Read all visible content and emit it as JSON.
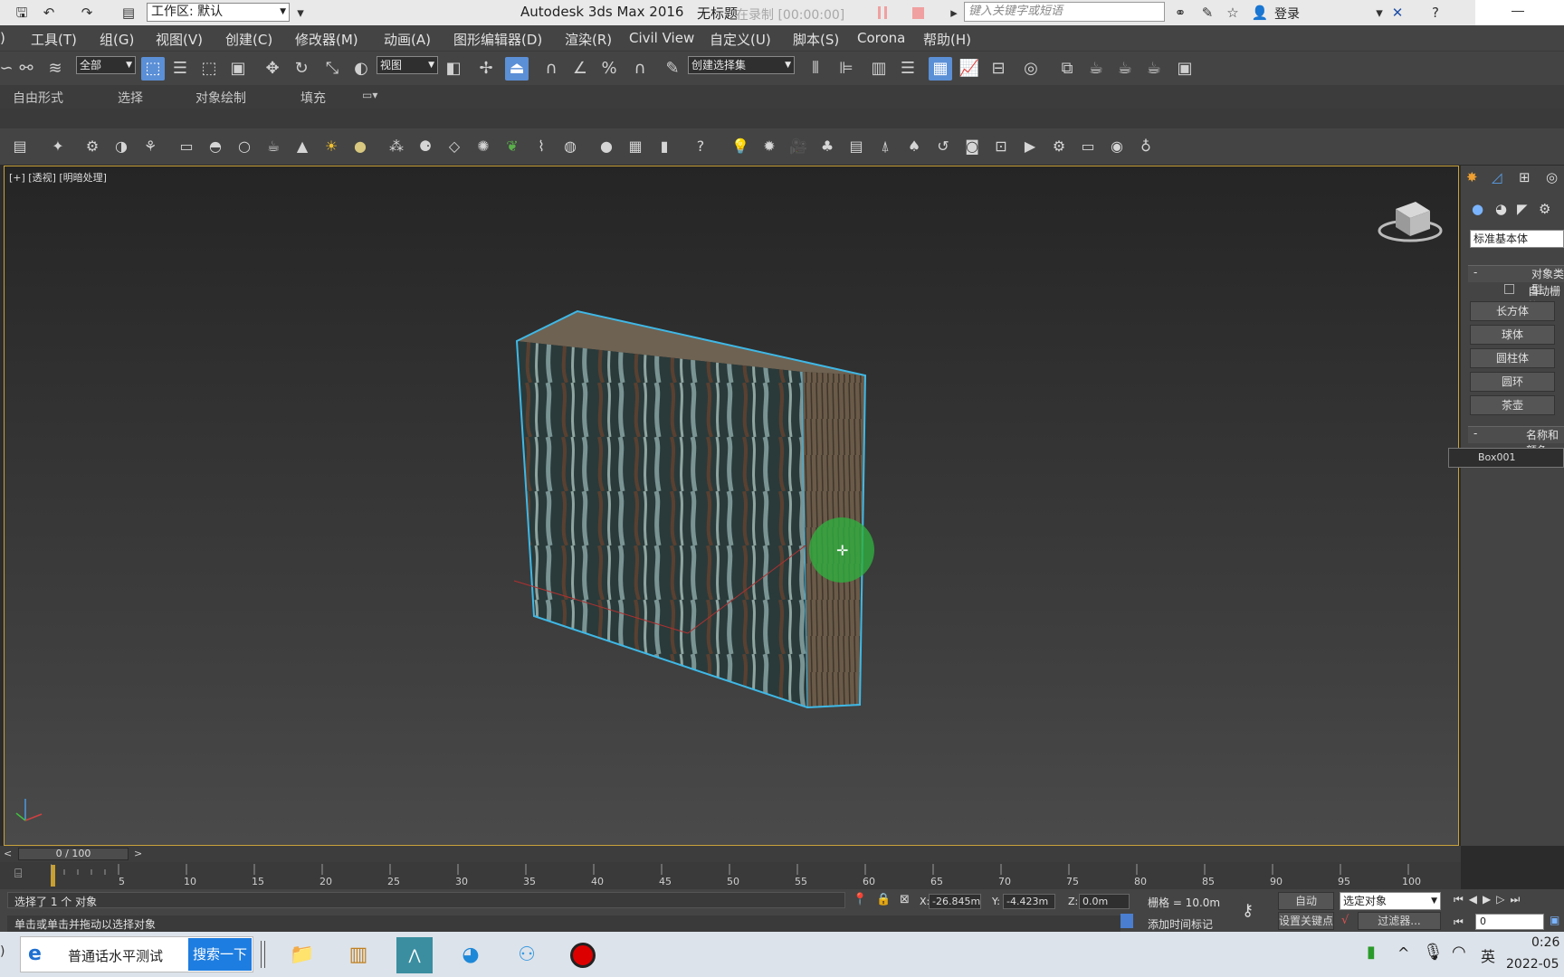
{
  "titlebar": {
    "workspace": "工作区: 默认",
    "app_title": "Autodesk 3ds Max 2016",
    "doc_title": "无标题",
    "recording": "在录制 [00:00:00]",
    "search_placeholder": "键入关键字或短语",
    "login": "登录"
  },
  "menu": [
    "工具(T)",
    "组(G)",
    "视图(V)",
    "创建(C)",
    "修改器(M)",
    "动画(A)",
    "图形编辑器(D)",
    "渲染(R)",
    "Civil View",
    "自定义(U)",
    "脚本(S)",
    "Corona",
    "帮助(H)"
  ],
  "toolbar": {
    "filter_dd": "全部",
    "ref_coord_dd": "视图",
    "selection_set_dd": "创建选择集"
  },
  "ribbon_tabs": [
    "自由形式",
    "选择",
    "对象绘制",
    "填充"
  ],
  "viewport": {
    "label": "[+] [透视] [明暗处理]"
  },
  "command_panel": {
    "category_dd": "标准基本体",
    "object_type_header": "对象类型",
    "autogrid": "自动栅格",
    "buttons": [
      "长方体",
      "球体",
      "圆柱体",
      "圆环",
      "茶壶"
    ],
    "name_color_header": "名称和颜色",
    "object_name": "Box001"
  },
  "timeline": {
    "frame": "0 / 100",
    "ticks": [
      "5",
      "10",
      "15",
      "20",
      "25",
      "30",
      "35",
      "40",
      "45",
      "50",
      "55",
      "60",
      "65",
      "70",
      "75",
      "80",
      "85",
      "90",
      "95",
      "100"
    ]
  },
  "status": {
    "selected": "选择了 1 个 对象",
    "hint": "单击或单击并拖动以选择对象",
    "x_label": "X:",
    "x": "-26.845m",
    "y_label": "Y:",
    "y": "-4.423m",
    "z_label": "Z:",
    "z": "0.0m",
    "grid": "栅格 = 10.0m",
    "add_time_tag": "添加时间标记",
    "auto": "自动",
    "set_key": "设置关键点",
    "selected_dd": "选定对象",
    "filters": "过滤器...",
    "frame_field": "0"
  },
  "taskbar": {
    "search_text": "普通话水平测试",
    "search_button": "搜索一下",
    "ime": "英",
    "time": "0:26",
    "date": "2022-05"
  },
  "colors": {
    "accent": "#5b8fd6",
    "viewport_border": "#c9a23a",
    "selection": "#3fb8e6"
  }
}
